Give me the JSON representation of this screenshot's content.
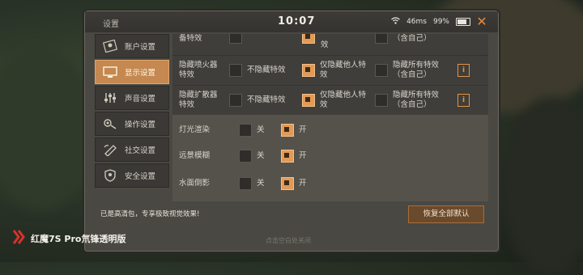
{
  "titlebar": {
    "title": "设置",
    "time": "10:07",
    "ping": "46ms",
    "battery": "99%"
  },
  "sidebar": {
    "items": [
      {
        "label": "账户设置",
        "icon": "account-icon",
        "active": false
      },
      {
        "label": "显示设置",
        "icon": "display-icon",
        "active": true
      },
      {
        "label": "声音设置",
        "icon": "sound-icon",
        "active": false
      },
      {
        "label": "操作设置",
        "icon": "controls-icon",
        "active": false
      },
      {
        "label": "社交设置",
        "icon": "social-icon",
        "active": false
      },
      {
        "label": "安全设置",
        "icon": "security-icon",
        "active": false
      }
    ]
  },
  "effects_rows": [
    {
      "label": "备特效",
      "options": [
        {
          "text": "",
          "checked": false
        },
        {
          "text": "效",
          "checked": true
        },
        {
          "text": "（含自己）",
          "checked": false
        }
      ]
    },
    {
      "label": "隐藏喷火器特效",
      "options": [
        {
          "text": "不隐藏特效",
          "checked": false
        },
        {
          "text": "仅隐藏他人特效",
          "checked": true
        },
        {
          "text": "隐藏所有特效（含自己）",
          "checked": false
        }
      ]
    },
    {
      "label": "隐藏扩散器特效",
      "options": [
        {
          "text": "不隐藏特效",
          "checked": false
        },
        {
          "text": "仅隐藏他人特效",
          "checked": true
        },
        {
          "text": "隐藏所有特效（含自己）",
          "checked": false
        }
      ]
    }
  ],
  "toggles": [
    {
      "label": "灯光渲染",
      "off": "关",
      "on": "开",
      "value": "on"
    },
    {
      "label": "远景模糊",
      "off": "关",
      "on": "开",
      "value": "on"
    },
    {
      "label": "水面倒影",
      "off": "关",
      "on": "开",
      "value": "on"
    }
  ],
  "footer": {
    "note": "已是高清包，专享极致视觉效果!",
    "restore_button": "恢复全部默认",
    "hint": "点击空白处关闭"
  },
  "watermark": {
    "text": "红魔7S Pro氘锋透明版"
  }
}
